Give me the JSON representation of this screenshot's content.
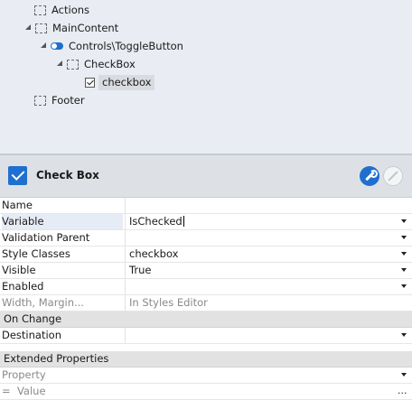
{
  "tree": {
    "items": [
      {
        "label": "Actions",
        "icon": "placeholder-icon",
        "expandable": false
      },
      {
        "label": "MainContent",
        "icon": "placeholder-icon",
        "expandable": true
      },
      {
        "label": "Controls\\ToggleButton",
        "icon": "toggle-icon",
        "expandable": true
      },
      {
        "label": "CheckBox",
        "icon": "placeholder-icon",
        "expandable": true
      },
      {
        "label": "checkbox",
        "icon": "checkbox-icon",
        "expandable": false,
        "selected": true
      },
      {
        "label": "Footer",
        "icon": "placeholder-icon",
        "expandable": false
      }
    ]
  },
  "header": {
    "title": "Check Box",
    "icon": "checkbox-checked-icon",
    "tools": [
      "wrench-icon",
      "disabled-icon"
    ]
  },
  "properties": {
    "rows": [
      {
        "name": "Name",
        "value": "",
        "dropdown": false
      },
      {
        "name": "Variable",
        "value": "IsChecked",
        "dropdown": true,
        "active": true
      },
      {
        "name": "Validation Parent",
        "value": "",
        "dropdown": true
      },
      {
        "name": "Style Classes",
        "value": "checkbox",
        "dropdown": true
      },
      {
        "name": "Visible",
        "value": "True",
        "dropdown": true
      },
      {
        "name": "Enabled",
        "value": "",
        "dropdown": true
      },
      {
        "name": "Width, Margin...",
        "value": "In Styles Editor",
        "dropdown": false,
        "dim": true
      }
    ],
    "on_change": {
      "section": "On Change",
      "rows": [
        {
          "name": "Destination",
          "value": "",
          "dropdown": true
        }
      ]
    },
    "extended": {
      "section": "Extended Properties",
      "property_placeholder": "Property",
      "value_prefix": "=",
      "value_placeholder": "Value",
      "ellipsis": "..."
    }
  },
  "colors": {
    "accent": "#1e6fd0",
    "tree_bg": "#e9ecf2",
    "header_bg": "#dde1e6",
    "section_bg": "#e2e2e2"
  }
}
